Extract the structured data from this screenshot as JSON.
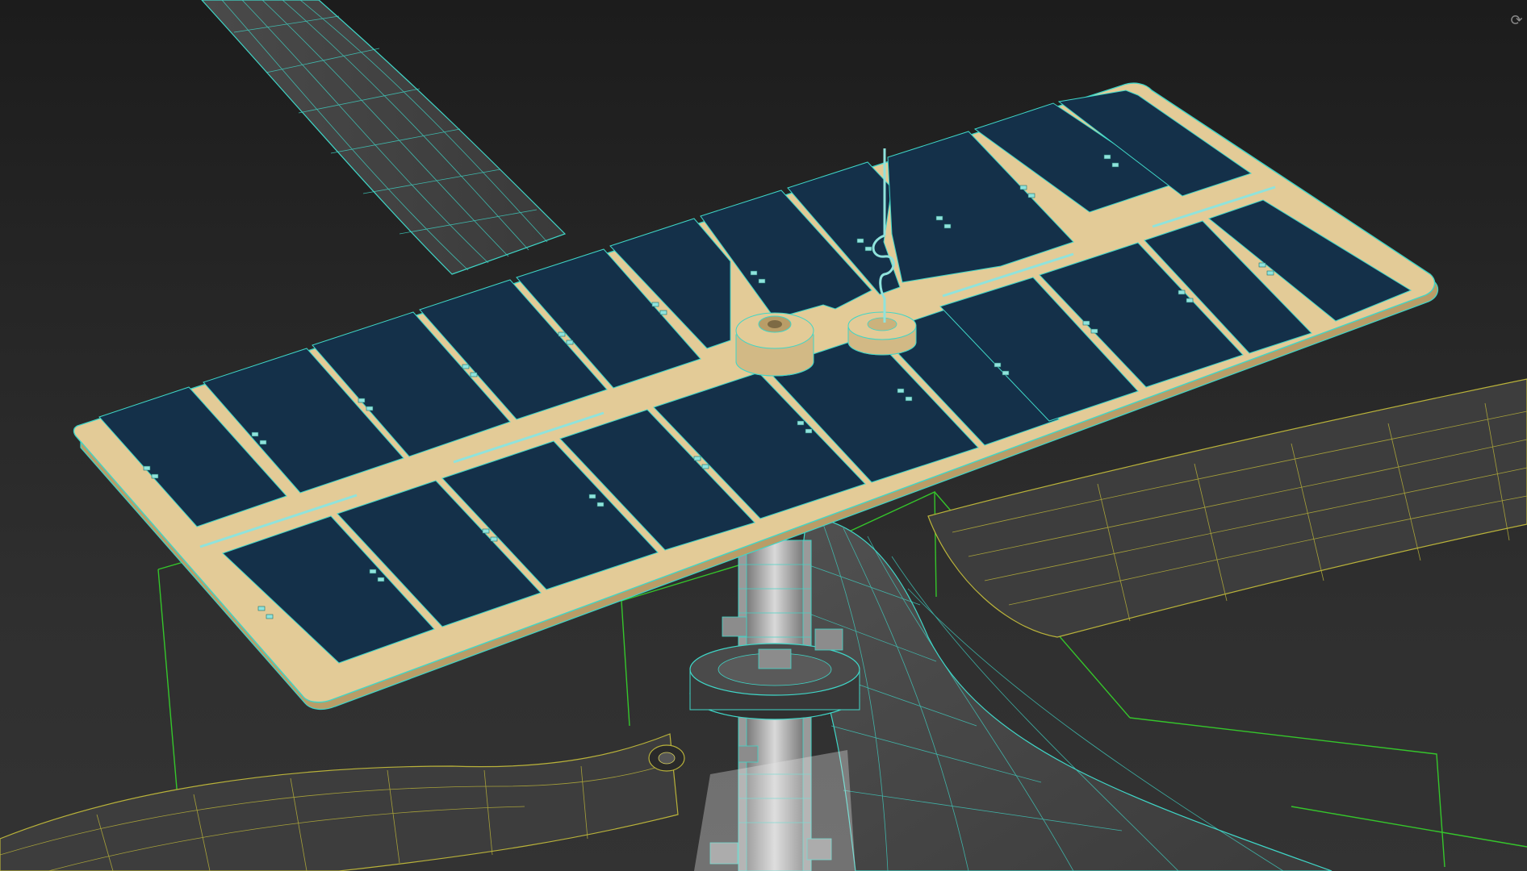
{
  "viewport": {
    "background": "#2b2b2b",
    "wireframe_color": "#3fd6c7",
    "selected_wire_color": "#b9b23a",
    "solar_cell_color": "#143049",
    "panel_frame_color": "#e3cb97",
    "grid_color": "#36e02a",
    "nav_gizmo_icon": "orbit-icon"
  }
}
